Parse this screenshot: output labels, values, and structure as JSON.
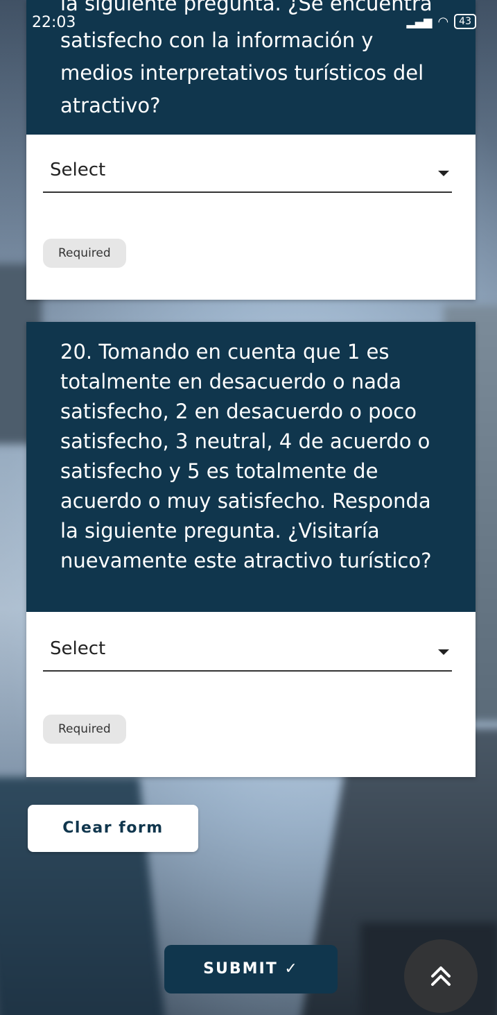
{
  "status_bar": {
    "time": "22:03",
    "battery": "43"
  },
  "question_19": {
    "title_lines": [
      "la siguiente pregunta. ¿Se encuentra",
      "satisfecho con la información y",
      "medios interpretativos turísticos del",
      "atractivo?"
    ],
    "select_placeholder": "Select",
    "required_label": "Required"
  },
  "question_20": {
    "title_lines": [
      "20. Tomando en cuenta que 1 es",
      "totalmente en desacuerdo o nada",
      "satisfecho, 2 en desacuerdo o poco",
      "satisfecho, 3 neutral, 4 de acuerdo o",
      "satisfecho y 5 es totalmente de",
      "acuerdo o muy satisfecho. Responda",
      "la siguiente pregunta. ¿Visitaría",
      "nuevamente este atractivo turístico?"
    ],
    "select_placeholder": "Select",
    "required_label": "Required"
  },
  "actions": {
    "clear_label": "Clear form",
    "submit_label": "SUBMIT ✓"
  },
  "icons": {
    "scroll_top": "double-chevron-up-icon",
    "dropdown": "caret-down-icon"
  },
  "colors": {
    "header_bg": "#10364d",
    "card_bg": "#ffffff",
    "badge_bg": "#e6e6e6"
  }
}
